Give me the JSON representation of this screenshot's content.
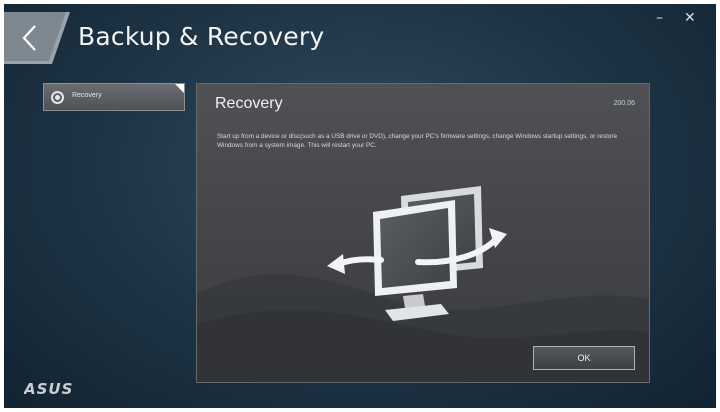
{
  "window": {
    "title": "Backup & Recovery",
    "minimize_glyph": "–",
    "close_glyph": "✕"
  },
  "sidebar": {
    "items": [
      {
        "label": "Recovery",
        "selected": true,
        "icon": "radio-selected-icon"
      }
    ]
  },
  "panel": {
    "title": "Recovery",
    "value": "200.06",
    "description": "Start up from a device or disc(such as a USB drive or DVD), change your PC's firmware settings, change Windows startup settings, or restore Windows from a system image. This will restart your PC.",
    "illustration_icon": "monitor-restart-icon",
    "ok_label": "OK"
  },
  "brand": {
    "logo_text": "ASUS",
    "logo_icon": "asus-logo"
  },
  "colors": {
    "background": "#1d3344",
    "panel": "#47494c",
    "text": "#f0f0f0"
  }
}
